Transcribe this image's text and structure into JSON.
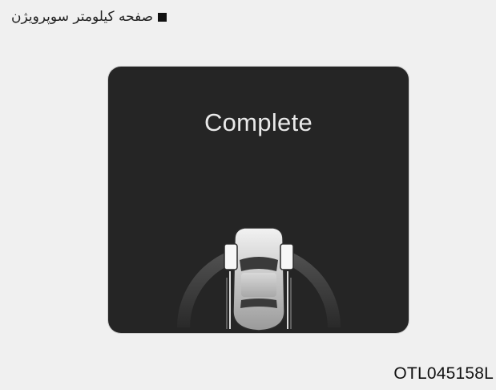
{
  "caption": {
    "text": "صفحه کیلومتر سوپرویژن"
  },
  "display": {
    "status_text": "Complete",
    "icons": [
      "square-bullet-icon",
      "vehicle-top-view-icon",
      "range-arc-icon"
    ]
  },
  "figure": {
    "code": "OTL045158L"
  },
  "colors": {
    "background": "#f0f0f0",
    "screen": "#252525",
    "text_light": "#e9e9e9",
    "text_dark": "#111111"
  }
}
